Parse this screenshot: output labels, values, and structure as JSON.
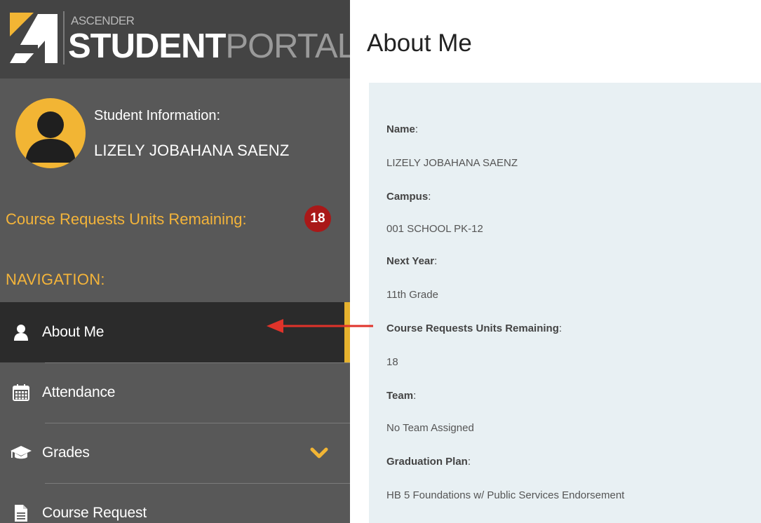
{
  "brand": {
    "top_text": "ASCENDER",
    "bold_text": "STUDENT",
    "light_text": "PORTAL"
  },
  "student": {
    "label": "Student Information:",
    "name": "LIZELY JOBAHANA SAENZ"
  },
  "units": {
    "label": "Course Requests Units Remaining:",
    "count": "18"
  },
  "navigation": {
    "title": "NAVIGATION:",
    "items": [
      {
        "label": "About Me",
        "icon": "user-icon",
        "active": true
      },
      {
        "label": "Attendance",
        "icon": "calendar-icon",
        "active": false
      },
      {
        "label": "Grades",
        "icon": "graduation-cap-icon",
        "active": false,
        "expandable": true
      },
      {
        "label": "Course Request",
        "icon": "document-icon",
        "active": false
      }
    ]
  },
  "main": {
    "title": "About Me",
    "fields": [
      {
        "label": "Name",
        "value": "LIZELY JOBAHANA SAENZ"
      },
      {
        "label": "Campus",
        "value": "001 SCHOOL PK-12"
      },
      {
        "label": "Next Year",
        "value": "11th Grade"
      },
      {
        "label": "Course Requests Units Remaining",
        "value": "18"
      },
      {
        "label": "Team",
        "value": "No Team Assigned"
      },
      {
        "label": "Graduation Plan",
        "value": "HB 5 Foundations w/ Public Services Endorsement"
      }
    ]
  },
  "colors": {
    "accent": "#f4b43a",
    "badge": "#a91818",
    "sidebar": "#585858",
    "active": "#2b2b2b",
    "arrow": "#e0332a"
  }
}
